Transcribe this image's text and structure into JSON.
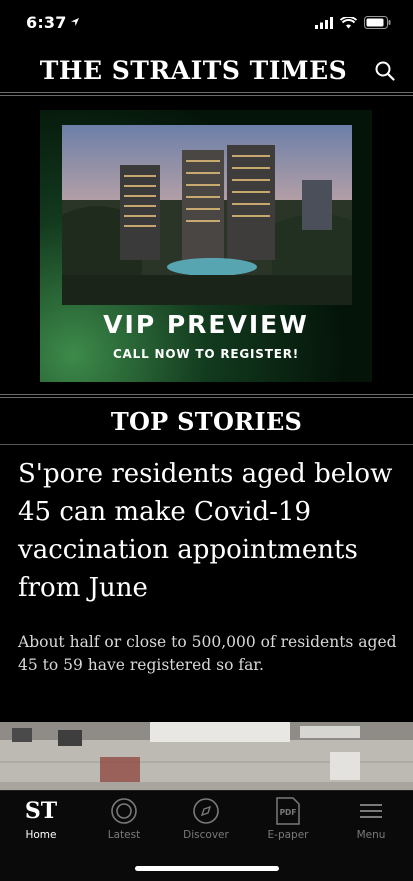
{
  "status_bar": {
    "time": "6:37"
  },
  "header": {
    "title": "THE STRAITS TIMES"
  },
  "ad": {
    "title": "VIP PREVIEW",
    "subtitle": "CALL NOW TO REGISTER!"
  },
  "section": {
    "title": "TOP STORIES"
  },
  "story": {
    "headline": "S'pore residents aged below 45 can make Covid-19 vaccination appointments from June",
    "summary": "About half or close to 500,000 of residents aged 45 to 59 have registered so far."
  },
  "tab_bar": {
    "items": [
      {
        "label": "Home",
        "icon": "st-logo-icon",
        "logo": "ST"
      },
      {
        "label": "Latest",
        "icon": "latest-icon"
      },
      {
        "label": "Discover",
        "icon": "compass-icon"
      },
      {
        "label": "E-paper",
        "icon": "pdf-icon",
        "badge": "PDF"
      },
      {
        "label": "Menu",
        "icon": "hamburger-icon"
      }
    ]
  }
}
